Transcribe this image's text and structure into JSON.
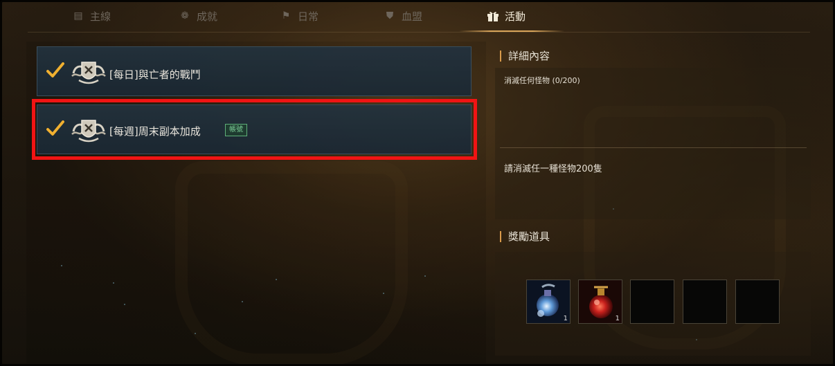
{
  "tabs": [
    {
      "label": "主線",
      "icon": "book-icon",
      "active": false
    },
    {
      "label": "成就",
      "icon": "medal-icon",
      "active": false
    },
    {
      "label": "日常",
      "icon": "flag-icon",
      "active": false
    },
    {
      "label": "血盟",
      "icon": "shield-icon",
      "active": false
    },
    {
      "label": "活動",
      "icon": "gift-icon",
      "active": true
    }
  ],
  "quests": [
    {
      "title": "[每日]與亡者的戰鬥",
      "completed": true,
      "badge": null
    },
    {
      "title": "[每週]周末副本加成",
      "completed": true,
      "badge": "帳號",
      "highlighted": true
    }
  ],
  "details": {
    "heading": "詳細內容",
    "progress": "消滅任何怪物 (0/200)",
    "description": "請消滅任一種怪物200隻"
  },
  "rewards": {
    "heading": "獎勵道具",
    "items": [
      {
        "icon": "blue-potion-icon",
        "quantity": "1"
      },
      {
        "icon": "red-potion-icon",
        "quantity": "1"
      },
      {
        "icon": "empty-slot",
        "quantity": ""
      },
      {
        "icon": "empty-slot",
        "quantity": ""
      },
      {
        "icon": "empty-slot",
        "quantity": ""
      }
    ]
  },
  "colors": {
    "accent": "#d99a4a",
    "highlight": "#f01414",
    "badge": "#5fb07a"
  }
}
